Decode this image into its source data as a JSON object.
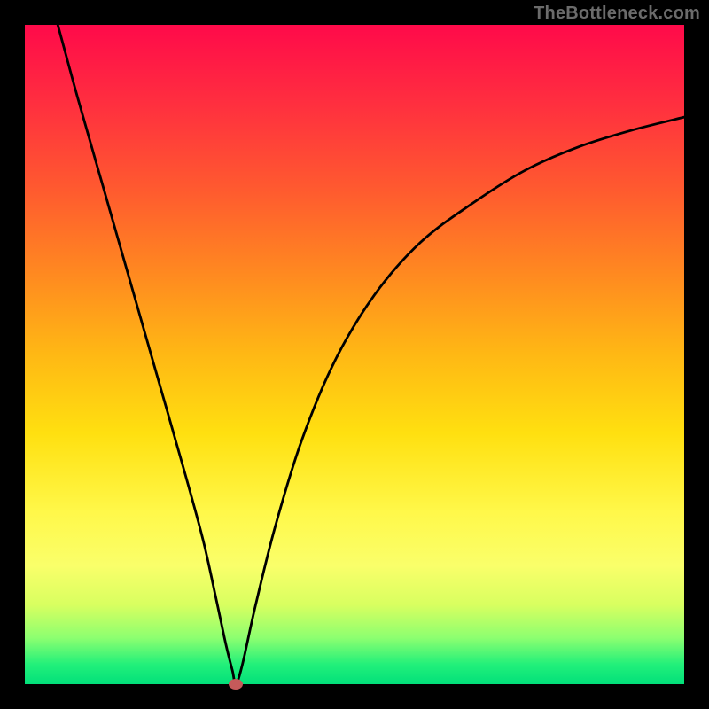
{
  "watermark": "TheBottleneck.com",
  "chart_data": {
    "type": "line",
    "title": "",
    "xlabel": "",
    "ylabel": "",
    "xlim": [
      0,
      100
    ],
    "ylim": [
      0,
      100
    ],
    "grid": false,
    "legend": false,
    "series": [
      {
        "name": "curve",
        "x": [
          5,
          8,
          12,
          16,
          20,
          24,
          27,
          29,
          30.5,
          31.5,
          32,
          33,
          35,
          38,
          42,
          47,
          53,
          60,
          68,
          76,
          84,
          92,
          100
        ],
        "y": [
          100,
          89,
          75,
          61,
          47,
          33,
          22,
          13,
          6,
          2,
          0,
          3,
          12,
          24,
          37,
          49,
          59,
          67,
          73,
          78,
          81.5,
          84,
          86
        ]
      }
    ],
    "marker": {
      "x": 32,
      "y": 0,
      "color": "#c55a5a"
    },
    "background_gradient": {
      "top": "#ff0a4a",
      "mid": "#ffe010",
      "bottom": "#02e07a"
    }
  }
}
